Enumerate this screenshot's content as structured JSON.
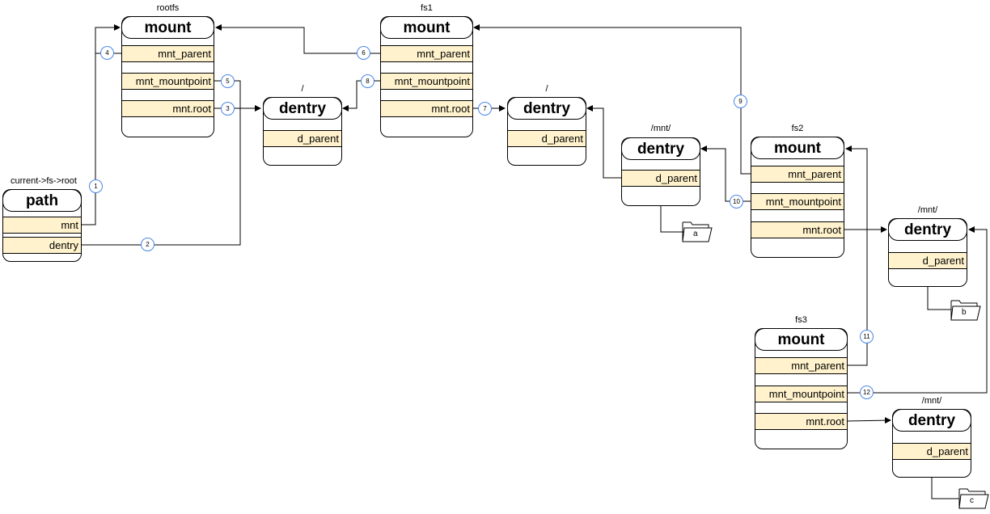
{
  "diagram": {
    "path": {
      "caption": "current->fs->root",
      "title": "path",
      "fields": [
        "mnt",
        "dentry"
      ]
    },
    "mounts": [
      {
        "id": "rootfs",
        "caption": "rootfs",
        "title": "mount",
        "fields": [
          "mnt_parent",
          "mnt_mountpoint",
          "mnt.root"
        ]
      },
      {
        "id": "fs1",
        "caption": "fs1",
        "title": "mount",
        "fields": [
          "mnt_parent",
          "mnt_mountpoint",
          "mnt.root"
        ]
      },
      {
        "id": "fs2",
        "caption": "fs2",
        "title": "mount",
        "fields": [
          "mnt_parent",
          "mnt_mountpoint",
          "mnt.root"
        ]
      },
      {
        "id": "fs3",
        "caption": "fs3",
        "title": "mount",
        "fields": [
          "mnt_parent",
          "mnt_mountpoint",
          "mnt.root"
        ]
      }
    ],
    "dentries": [
      {
        "id": "rootfs-root",
        "caption": "/",
        "title": "dentry",
        "field": "d_parent"
      },
      {
        "id": "fs1-root",
        "caption": "/",
        "title": "dentry",
        "field": "d_parent"
      },
      {
        "id": "fs1-mnt",
        "caption": "/mnt/",
        "title": "dentry",
        "field": "d_parent",
        "child": "a"
      },
      {
        "id": "fs2-root",
        "caption": "/mnt/",
        "title": "dentry",
        "field": "d_parent",
        "child": "b"
      },
      {
        "id": "fs3-root",
        "caption": "/mnt/",
        "title": "dentry",
        "field": "d_parent",
        "child": "c"
      }
    ],
    "steps": [
      "1",
      "2",
      "3",
      "4",
      "5",
      "6",
      "7",
      "8",
      "9",
      "10",
      "11",
      "12"
    ],
    "colors": {
      "field_fill": "#fff2cc",
      "badge_stroke": "#4a86e8",
      "line": "#000000"
    }
  }
}
